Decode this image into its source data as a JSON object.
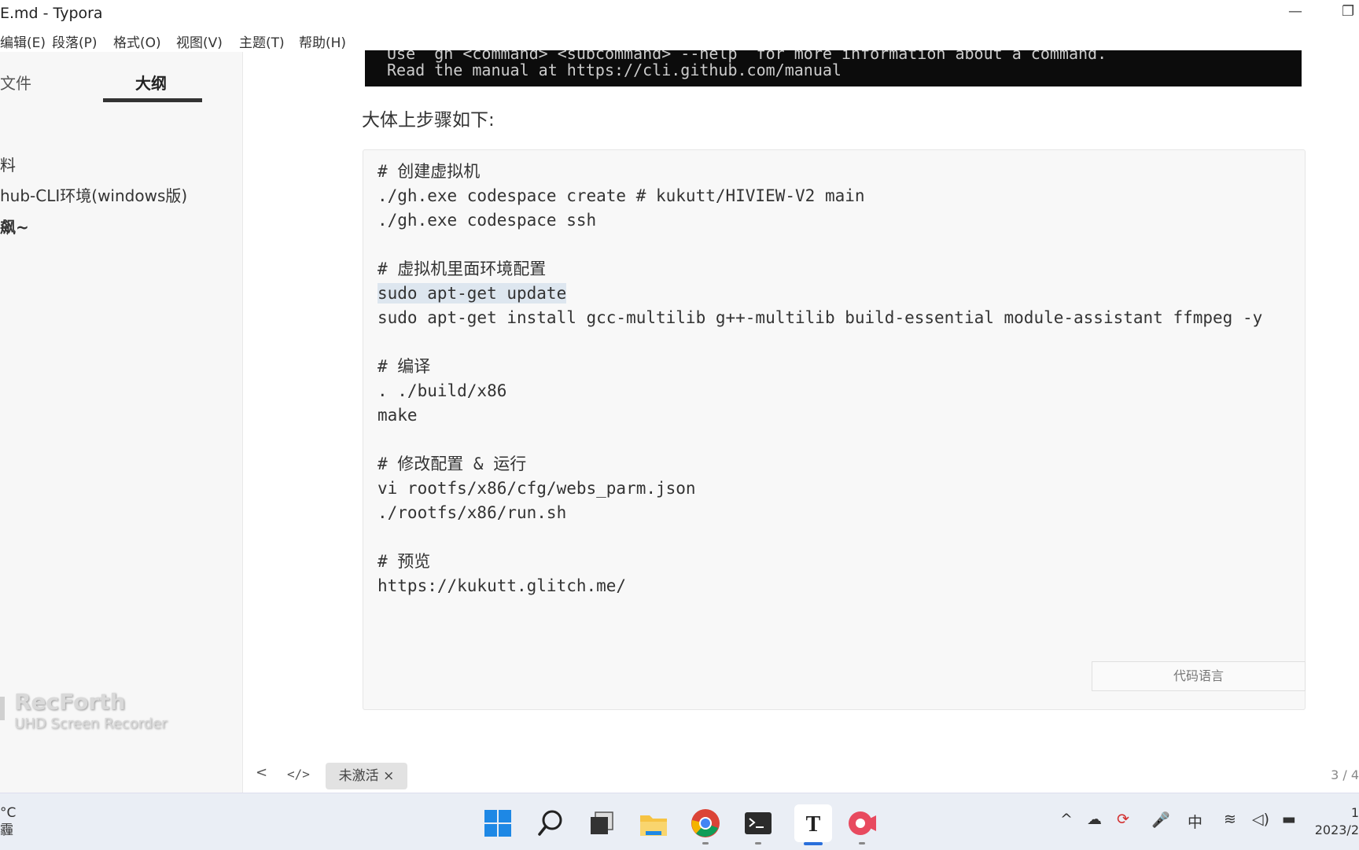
{
  "window": {
    "title": "E.md - Typora",
    "minimize_glyph": "—",
    "restore_glyph": "❐"
  },
  "menu": [
    "编辑(E)",
    "段落(P)",
    "格式(O)",
    "视图(V)",
    "主题(T)",
    "帮助(H)"
  ],
  "sidebar": {
    "tabs": [
      "文件",
      "大纲"
    ],
    "active_tab": "大纲",
    "outline_items": [
      "料",
      "hub-CLI环境(windows版)",
      "飙~"
    ]
  },
  "watermark": {
    "title": "RecForth",
    "subtitle": "UHD Screen Recorder"
  },
  "terminal": {
    "lines": [
      "Use  gh <command> <subcommand> --help  for more information about a command.",
      "Read the manual at https://cli.github.com/manual"
    ]
  },
  "content": {
    "paragraph": "大体上步骤如下:",
    "code_lines": [
      "# 创建虚拟机",
      "./gh.exe codespace create # kukutt/HIVIEW-V2 main",
      "./gh.exe codespace ssh",
      "",
      "# 虚拟机里面环境配置",
      "sudo apt-get update",
      "sudo apt-get install gcc-multilib g++-multilib build-essential module-assistant ffmpeg -y",
      "",
      "# 编译",
      ". ./build/x86",
      "make",
      "",
      "# 修改配置 & 运行",
      "vi rootfs/x86/cfg/webs_parm.json",
      "./rootfs/x86/run.sh",
      "",
      "# 预览",
      "https://kukutt.glitch.me/"
    ],
    "selected_line": "sudo apt-get update",
    "code_language_placeholder": "代码语言"
  },
  "statusbar": {
    "back_glyph": "<",
    "source_glyph": "</>",
    "activation_badge": "未激活 ×",
    "page_count": "3 / 4"
  },
  "taskbar": {
    "weather_temp": "°C",
    "weather_desc": "霾",
    "ime": "中",
    "clock_time": "1",
    "clock_date": "2023/2"
  },
  "colors": {
    "terminal_bg": "#0c0c0c",
    "selection": "#dde6ef",
    "accent": "#2a6fdb"
  }
}
